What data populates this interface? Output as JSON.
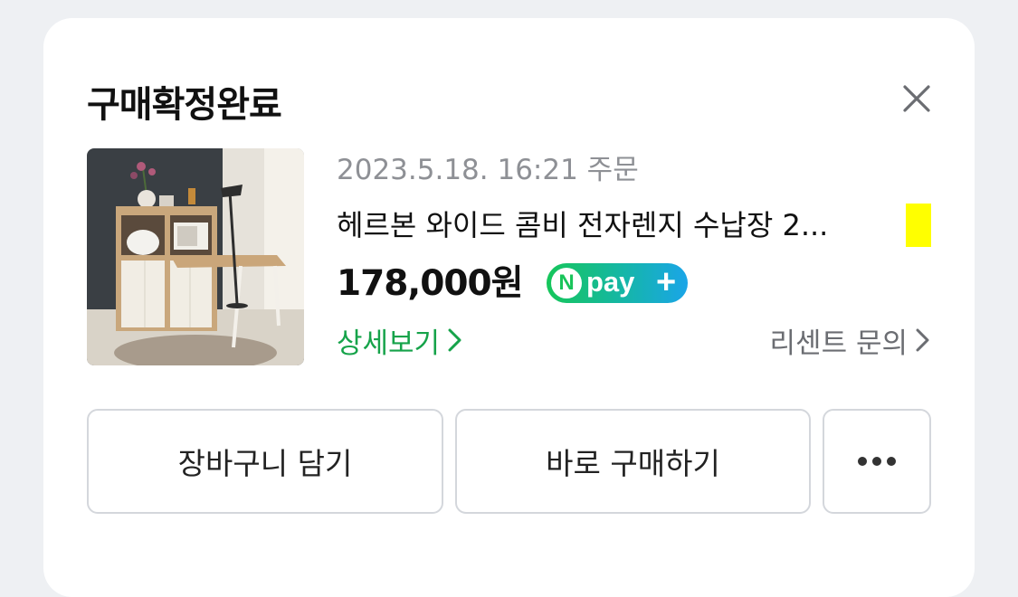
{
  "dialog": {
    "title": "구매확정완료",
    "close_icon": "close-icon"
  },
  "order": {
    "date": "2023.5.18. 16:21 주문",
    "product_name": "헤르본 와이드 콤비 전자렌지 수납장 2...",
    "price": "178,000원",
    "payment_badge": {
      "n": "N",
      "text": "pay",
      "plus": "+"
    },
    "detail_link": "상세보기",
    "seller_link": "리센트 문의",
    "image_icon": "product-thumbnail"
  },
  "actions": {
    "cart_label": "장바구니 담기",
    "buy_label": "바로 구매하기",
    "more_icon": "more-icon"
  },
  "colors": {
    "accent_green": "#16a34a",
    "npay_green": "#16c65a",
    "npay_blue": "#1aa5e8",
    "highlight": "#ffff00"
  }
}
